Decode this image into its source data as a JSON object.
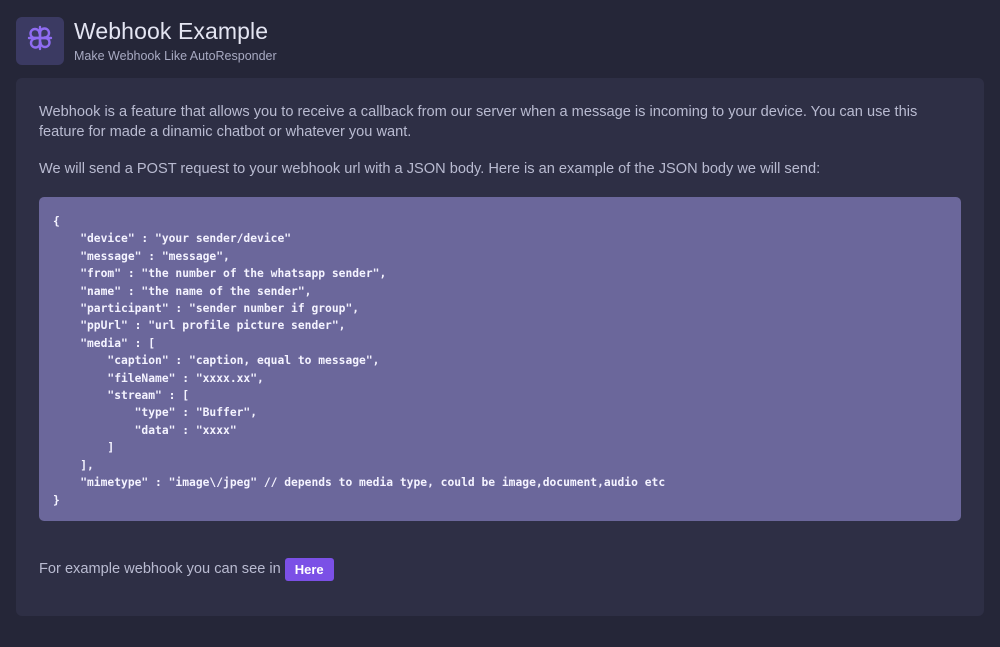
{
  "header": {
    "title": "Webhook Example",
    "subtitle": "Make Webhook Like AutoResponder",
    "logo_icon": "webhook-icon"
  },
  "content": {
    "intro": "Webhook is a feature that allows you to receive a callback from our server when a message is incoming to your device. You can use this feature for made a dinamic chatbot or whatever you want.",
    "post_info": "We will send a POST request to your webhook url with a JSON body. Here is an example of the JSON body we will send:",
    "code_example": "{\n    \"device\" : \"your sender/device\"\n    \"message\" : \"message\",\n    \"from\" : \"the number of the whatsapp sender\",\n    \"name\" : \"the name of the sender\",\n    \"participant\" : \"sender number if group\",\n    \"ppUrl\" : \"url profile picture sender\",\n    \"media\" : [\n        \"caption\" : \"caption, equal to message\",\n        \"fileName\" : \"xxxx.xx\",\n        \"stream\" : [\n            \"type\" : \"Buffer\",\n            \"data\" : \"xxxx\"\n        ]\n    ],\n    \"mimetype\" : \"image\\/jpeg\" // depends to media type, could be image,document,audio etc\n}",
    "footer_text": "For example webhook you can see in",
    "here_label": "Here"
  },
  "colors": {
    "background": "#252638",
    "card": "#2e2f45",
    "code_bg": "#6b679b",
    "accent": "#7b50e6"
  }
}
